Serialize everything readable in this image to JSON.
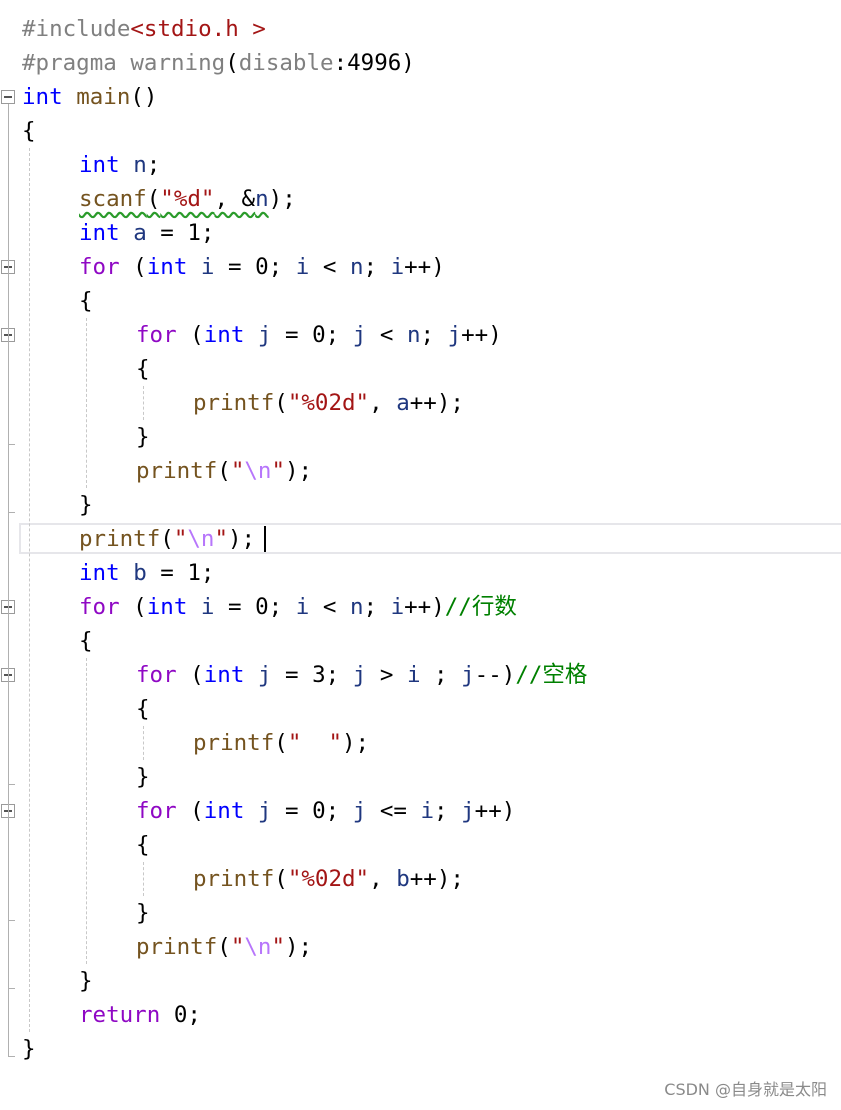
{
  "editor": {
    "lines": [
      {
        "indent": 0,
        "tokens": [
          {
            "t": "#include",
            "c": "dir"
          },
          {
            "t": "<stdio.h >",
            "c": "hdr"
          }
        ]
      },
      {
        "indent": 0,
        "tokens": [
          {
            "t": "#pragma warning",
            "c": "dir"
          },
          {
            "t": "(",
            "c": "pun"
          },
          {
            "t": "disable",
            "c": "dir"
          },
          {
            "t": ":4996)",
            "c": "pun"
          }
        ]
      },
      {
        "indent": 0,
        "fold": true,
        "tokens": [
          {
            "t": "int",
            "c": "kw"
          },
          {
            "t": " ",
            "c": "pun"
          },
          {
            "t": "main",
            "c": "fn"
          },
          {
            "t": "()",
            "c": "pun"
          }
        ]
      },
      {
        "indent": 0,
        "tokens": [
          {
            "t": "{",
            "c": "pun"
          }
        ]
      },
      {
        "indent": 1,
        "tokens": [
          {
            "t": "int",
            "c": "kw"
          },
          {
            "t": " ",
            "c": "pun"
          },
          {
            "t": "n",
            "c": "id"
          },
          {
            "t": ";",
            "c": "pun"
          }
        ]
      },
      {
        "indent": 1,
        "tokens": [
          {
            "t": "scanf",
            "c": "fn sq"
          },
          {
            "t": "(",
            "c": "pun sq"
          },
          {
            "t": "\"%d\"",
            "c": "str sq"
          },
          {
            "t": ", &",
            "c": "pun sq"
          },
          {
            "t": "n",
            "c": "id sq"
          },
          {
            "t": ");",
            "c": "pun"
          }
        ]
      },
      {
        "indent": 1,
        "tokens": [
          {
            "t": "int",
            "c": "kw"
          },
          {
            "t": " ",
            "c": "pun"
          },
          {
            "t": "a",
            "c": "id"
          },
          {
            "t": " = 1;",
            "c": "pun"
          }
        ]
      },
      {
        "indent": 1,
        "fold": true,
        "tokens": [
          {
            "t": "for",
            "c": "ctl"
          },
          {
            "t": " (",
            "c": "pun"
          },
          {
            "t": "int",
            "c": "kw"
          },
          {
            "t": " ",
            "c": "pun"
          },
          {
            "t": "i",
            "c": "id"
          },
          {
            "t": " = 0; ",
            "c": "pun"
          },
          {
            "t": "i",
            "c": "id"
          },
          {
            "t": " < ",
            "c": "pun"
          },
          {
            "t": "n",
            "c": "id"
          },
          {
            "t": "; ",
            "c": "pun"
          },
          {
            "t": "i",
            "c": "id"
          },
          {
            "t": "++)",
            "c": "pun"
          }
        ]
      },
      {
        "indent": 1,
        "tokens": [
          {
            "t": "{",
            "c": "pun"
          }
        ]
      },
      {
        "indent": 2,
        "fold": true,
        "tokens": [
          {
            "t": "for",
            "c": "ctl"
          },
          {
            "t": " (",
            "c": "pun"
          },
          {
            "t": "int",
            "c": "kw"
          },
          {
            "t": " ",
            "c": "pun"
          },
          {
            "t": "j",
            "c": "id"
          },
          {
            "t": " = 0; ",
            "c": "pun"
          },
          {
            "t": "j",
            "c": "id"
          },
          {
            "t": " < ",
            "c": "pun"
          },
          {
            "t": "n",
            "c": "id"
          },
          {
            "t": "; ",
            "c": "pun"
          },
          {
            "t": "j",
            "c": "id"
          },
          {
            "t": "++)",
            "c": "pun"
          }
        ]
      },
      {
        "indent": 2,
        "tokens": [
          {
            "t": "{",
            "c": "pun"
          }
        ]
      },
      {
        "indent": 3,
        "tokens": [
          {
            "t": "printf",
            "c": "fn"
          },
          {
            "t": "(",
            "c": "pun"
          },
          {
            "t": "\"%02d\"",
            "c": "str"
          },
          {
            "t": ", ",
            "c": "pun"
          },
          {
            "t": "a",
            "c": "id"
          },
          {
            "t": "++);",
            "c": "pun"
          }
        ]
      },
      {
        "indent": 2,
        "tokens": [
          {
            "t": "}",
            "c": "pun"
          }
        ]
      },
      {
        "indent": 2,
        "tokens": [
          {
            "t": "printf",
            "c": "fn"
          },
          {
            "t": "(",
            "c": "pun"
          },
          {
            "t": "\"",
            "c": "str"
          },
          {
            "t": "\\n",
            "c": "esc"
          },
          {
            "t": "\"",
            "c": "str"
          },
          {
            "t": ");",
            "c": "pun"
          }
        ]
      },
      {
        "indent": 1,
        "tokens": [
          {
            "t": "}",
            "c": "pun"
          }
        ]
      },
      {
        "indent": 1,
        "tokens": [
          {
            "t": "printf",
            "c": "fn"
          },
          {
            "t": "(",
            "c": "pun"
          },
          {
            "t": "\"",
            "c": "str"
          },
          {
            "t": "\\n",
            "c": "esc"
          },
          {
            "t": "\"",
            "c": "str"
          },
          {
            "t": ");",
            "c": "pun"
          }
        ]
      },
      {
        "indent": 1,
        "tokens": [
          {
            "t": "int",
            "c": "kw"
          },
          {
            "t": " ",
            "c": "pun"
          },
          {
            "t": "b",
            "c": "id"
          },
          {
            "t": " = 1;",
            "c": "pun"
          }
        ]
      },
      {
        "indent": 1,
        "fold": true,
        "tokens": [
          {
            "t": "for",
            "c": "ctl"
          },
          {
            "t": " (",
            "c": "pun"
          },
          {
            "t": "int",
            "c": "kw"
          },
          {
            "t": " ",
            "c": "pun"
          },
          {
            "t": "i",
            "c": "id"
          },
          {
            "t": " = 0; ",
            "c": "pun"
          },
          {
            "t": "i",
            "c": "id"
          },
          {
            "t": " < ",
            "c": "pun"
          },
          {
            "t": "n",
            "c": "id"
          },
          {
            "t": "; ",
            "c": "pun"
          },
          {
            "t": "i",
            "c": "id"
          },
          {
            "t": "++)",
            "c": "pun"
          },
          {
            "t": "//行数",
            "c": "cm"
          }
        ]
      },
      {
        "indent": 1,
        "tokens": [
          {
            "t": "{",
            "c": "pun"
          }
        ]
      },
      {
        "indent": 2,
        "fold": true,
        "tokens": [
          {
            "t": "for",
            "c": "ctl"
          },
          {
            "t": " (",
            "c": "pun"
          },
          {
            "t": "int",
            "c": "kw"
          },
          {
            "t": " ",
            "c": "pun"
          },
          {
            "t": "j",
            "c": "id"
          },
          {
            "t": " = 3; ",
            "c": "pun"
          },
          {
            "t": "j",
            "c": "id"
          },
          {
            "t": " > ",
            "c": "pun"
          },
          {
            "t": "i",
            "c": "id"
          },
          {
            "t": " ; ",
            "c": "pun"
          },
          {
            "t": "j",
            "c": "id"
          },
          {
            "t": "--)",
            "c": "pun"
          },
          {
            "t": "//空格",
            "c": "cm"
          }
        ]
      },
      {
        "indent": 2,
        "tokens": [
          {
            "t": "{",
            "c": "pun"
          }
        ]
      },
      {
        "indent": 3,
        "tokens": [
          {
            "t": "printf",
            "c": "fn"
          },
          {
            "t": "(",
            "c": "pun"
          },
          {
            "t": "\"  \"",
            "c": "str"
          },
          {
            "t": ");",
            "c": "pun"
          }
        ]
      },
      {
        "indent": 2,
        "tokens": [
          {
            "t": "}",
            "c": "pun"
          }
        ]
      },
      {
        "indent": 2,
        "fold": true,
        "tokens": [
          {
            "t": "for",
            "c": "ctl"
          },
          {
            "t": " (",
            "c": "pun"
          },
          {
            "t": "int",
            "c": "kw"
          },
          {
            "t": " ",
            "c": "pun"
          },
          {
            "t": "j",
            "c": "id"
          },
          {
            "t": " = 0; ",
            "c": "pun"
          },
          {
            "t": "j",
            "c": "id"
          },
          {
            "t": " <= ",
            "c": "pun"
          },
          {
            "t": "i",
            "c": "id"
          },
          {
            "t": "; ",
            "c": "pun"
          },
          {
            "t": "j",
            "c": "id"
          },
          {
            "t": "++)",
            "c": "pun"
          }
        ]
      },
      {
        "indent": 2,
        "tokens": [
          {
            "t": "{",
            "c": "pun"
          }
        ]
      },
      {
        "indent": 3,
        "tokens": [
          {
            "t": "printf",
            "c": "fn"
          },
          {
            "t": "(",
            "c": "pun"
          },
          {
            "t": "\"%02d\"",
            "c": "str"
          },
          {
            "t": ", ",
            "c": "pun"
          },
          {
            "t": "b",
            "c": "id"
          },
          {
            "t": "++);",
            "c": "pun"
          }
        ]
      },
      {
        "indent": 2,
        "tokens": [
          {
            "t": "}",
            "c": "pun"
          }
        ]
      },
      {
        "indent": 2,
        "tokens": [
          {
            "t": "printf",
            "c": "fn"
          },
          {
            "t": "(",
            "c": "pun"
          },
          {
            "t": "\"",
            "c": "str"
          },
          {
            "t": "\\n",
            "c": "esc"
          },
          {
            "t": "\"",
            "c": "str"
          },
          {
            "t": ");",
            "c": "pun"
          }
        ]
      },
      {
        "indent": 1,
        "tokens": [
          {
            "t": "}",
            "c": "pun"
          }
        ]
      },
      {
        "indent": 1,
        "tokens": [
          {
            "t": "return",
            "c": "ctl"
          },
          {
            "t": " 0;",
            "c": "pun"
          }
        ]
      },
      {
        "indent": 0,
        "tokens": [
          {
            "t": "}",
            "c": "pun"
          }
        ]
      }
    ],
    "current_line": 16
  },
  "watermark": "CSDN @自身就是太阳"
}
